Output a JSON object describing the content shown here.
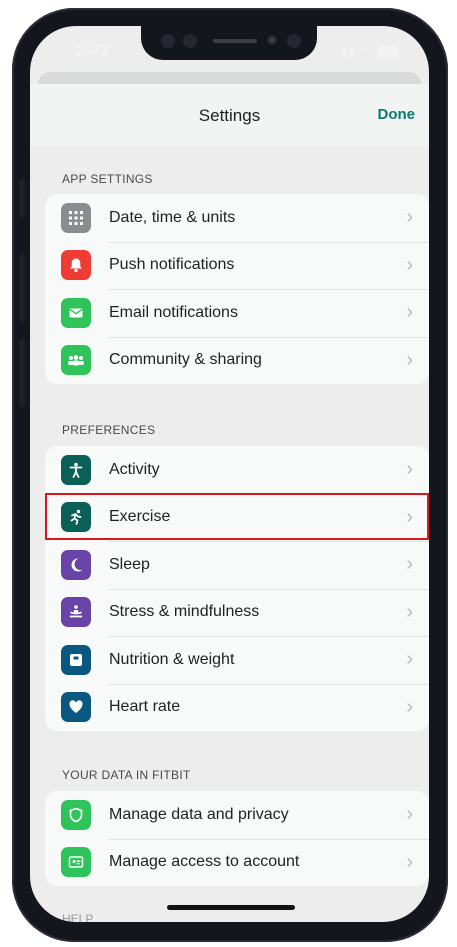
{
  "status": {
    "time": "2:43"
  },
  "header": {
    "title": "Settings",
    "done_label": "Done"
  },
  "sections": {
    "app_settings": {
      "title": "APP SETTINGS",
      "items": [
        {
          "label": "Date, time & units",
          "icon": "grid-icon",
          "color": "#8a8c8f"
        },
        {
          "label": "Push notifications",
          "icon": "bell-icon",
          "color": "#ee3b33"
        },
        {
          "label": "Email notifications",
          "icon": "envelope-icon",
          "color": "#2ec45a"
        },
        {
          "label": "Community & sharing",
          "icon": "people-icon",
          "color": "#2ec45a"
        }
      ]
    },
    "preferences": {
      "title": "PREFERENCES",
      "items": [
        {
          "label": "Activity",
          "icon": "person-icon",
          "color": "#0a5f57"
        },
        {
          "label": "Exercise",
          "icon": "runner-icon",
          "color": "#0a5f57"
        },
        {
          "label": "Sleep",
          "icon": "moon-icon",
          "color": "#6a43a6"
        },
        {
          "label": "Stress & mindfulness",
          "icon": "meditation-icon",
          "color": "#6a43a6"
        },
        {
          "label": "Nutrition & weight",
          "icon": "scale-icon",
          "color": "#0a5880"
        },
        {
          "label": "Heart rate",
          "icon": "heart-icon",
          "color": "#0a5880"
        }
      ]
    },
    "your_data": {
      "title": "YOUR DATA IN FITBIT",
      "items": [
        {
          "label": "Manage data and privacy",
          "icon": "shield-icon",
          "color": "#2ec45a"
        },
        {
          "label": "Manage access to account",
          "icon": "account-card-icon",
          "color": "#2ec45a"
        }
      ]
    }
  },
  "bottom_partial_heading": "HELP",
  "highlight": {
    "target": "Exercise",
    "color": "#d7191f"
  }
}
